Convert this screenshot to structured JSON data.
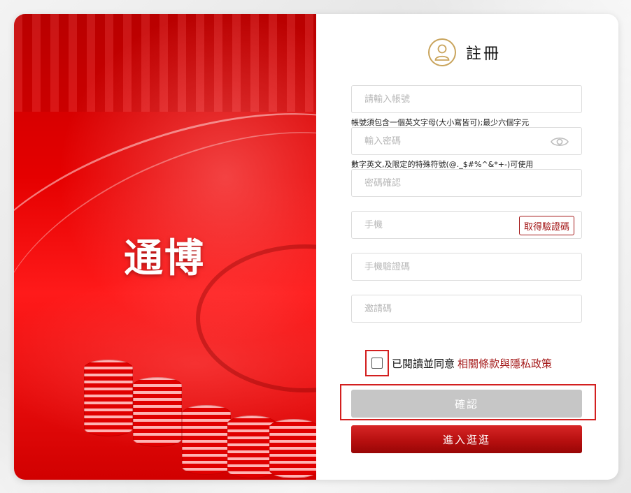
{
  "hero": {
    "logo_text": "通博"
  },
  "form": {
    "title": "註冊",
    "account": {
      "placeholder": "請輸入帳號",
      "hint": "帳號須包含一個英文字母(大小寫皆可);最少六個字元"
    },
    "password": {
      "placeholder": "輸入密碼",
      "hint": "數字英文,及限定的特殊符號(@._$#%^&*+-)可使用"
    },
    "password_confirm": {
      "placeholder": "密碼確認"
    },
    "phone": {
      "placeholder": "手機",
      "sms_button": "取得驗證碼"
    },
    "phone_code": {
      "placeholder": "手機驗證碼"
    },
    "invite_code": {
      "placeholder": "邀請碼"
    },
    "agree": {
      "text": "已閱讀並同意",
      "link": "相關條款與隱私政策",
      "checked": false
    },
    "confirm_button": "確認",
    "guest_button": "進入逛逛"
  },
  "colors": {
    "brand_red": "#a41818",
    "highlight_red": "#d31f1f",
    "gold": "#c9a45c",
    "disabled_gray": "#c6c6c6"
  }
}
